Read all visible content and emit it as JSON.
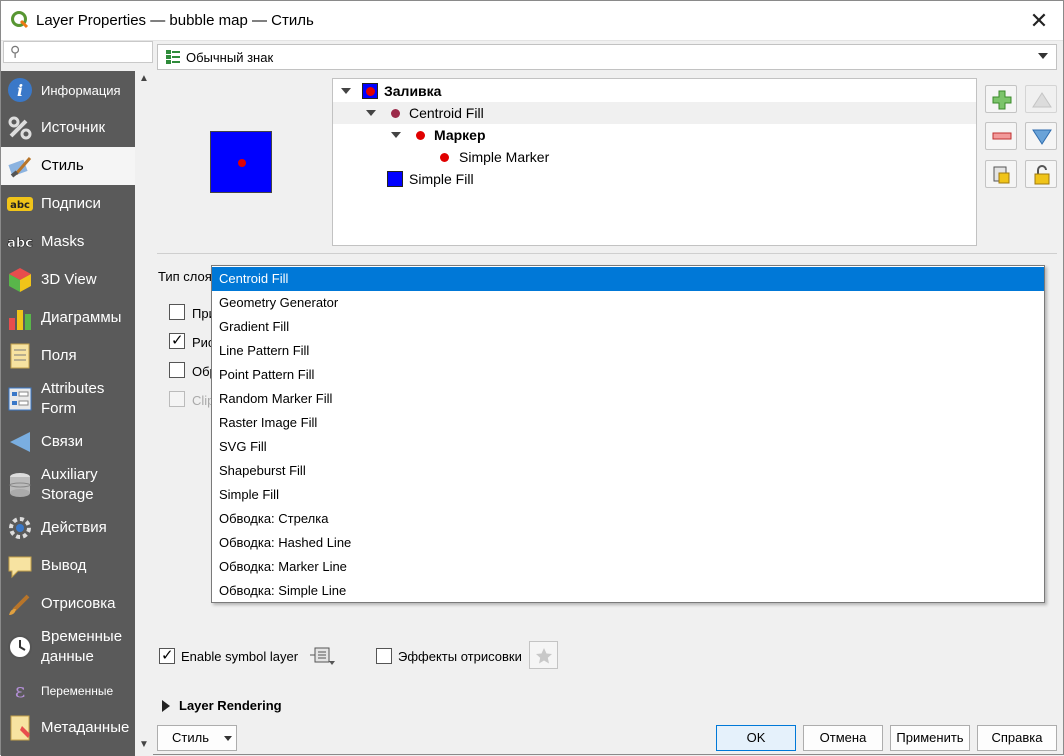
{
  "window": {
    "title": "Layer Properties — bubble map — Стиль",
    "close": "✕"
  },
  "sidebar": {
    "search_placeholder": "",
    "items": [
      {
        "label": "Информация",
        "icon": "info-icon"
      },
      {
        "label": "Источник",
        "icon": "source-icon"
      },
      {
        "label": "Стиль",
        "icon": "style-brush-icon",
        "active": true
      },
      {
        "label": "Подписи",
        "icon": "labels-abc-icon"
      },
      {
        "label": "Masks",
        "icon": "masks-abc-icon"
      },
      {
        "label": "3D View",
        "icon": "cube-3d-icon"
      },
      {
        "label": "Диаграммы",
        "icon": "diagram-icon"
      },
      {
        "label": "Поля",
        "icon": "fields-icon"
      },
      {
        "label": "Attributes Form",
        "icon": "form-icon"
      },
      {
        "label": "Связи",
        "icon": "joins-icon"
      },
      {
        "label": "Auxiliary Storage",
        "icon": "database-icon"
      },
      {
        "label": "Действия",
        "icon": "actions-gear-icon"
      },
      {
        "label": "Вывод",
        "icon": "display-bubble-icon"
      },
      {
        "label": "Отрисовка",
        "icon": "rendering-brush-icon"
      },
      {
        "label": "Временные данные",
        "icon": "clock-icon"
      },
      {
        "label": "Переменные",
        "icon": "variables-epsilon-icon"
      },
      {
        "label": "Метаданные",
        "icon": "metadata-icon"
      }
    ]
  },
  "renderer": {
    "selected": "Обычный знак"
  },
  "symbol_tree": [
    {
      "label": "Заливка",
      "bold": true,
      "level": 0
    },
    {
      "label": "Centroid Fill",
      "bold": false,
      "level": 1
    },
    {
      "label": "Маркер",
      "bold": true,
      "level": 2
    },
    {
      "label": "Simple Marker",
      "bold": false,
      "level": 3
    },
    {
      "label": "Simple Fill",
      "bold": false,
      "level": 1
    }
  ],
  "layer_type": {
    "label": "Тип слоя",
    "options": [
      "Centroid Fill",
      "Geometry Generator",
      "Gradient Fill",
      "Line Pattern Fill",
      "Point Pattern Fill",
      "Random Marker Fill",
      "Raster Image Fill",
      "SVG Fill",
      "Shapeburst Fill",
      "Simple Fill",
      "Обводка: Стрелка",
      "Обводка: Hashed Line",
      "Обводка: Marker Line",
      "Обводка: Simple Line"
    ],
    "selected_index": 0
  },
  "partial_options": [
    "При",
    "Рис",
    "Обр",
    "Clip"
  ],
  "enable_symbol_layer": "Enable symbol layer",
  "draw_effects": "Эффекты отрисовки",
  "layer_rendering": "Layer Rendering",
  "buttons": {
    "style": "Стиль",
    "ok": "OK",
    "cancel": "Отмена",
    "apply": "Применить",
    "help": "Справка"
  },
  "colors": {
    "accent": "#0078d7",
    "sidebar": "#5a5a5a",
    "fill": "#0000ff",
    "marker": "#e00000"
  }
}
